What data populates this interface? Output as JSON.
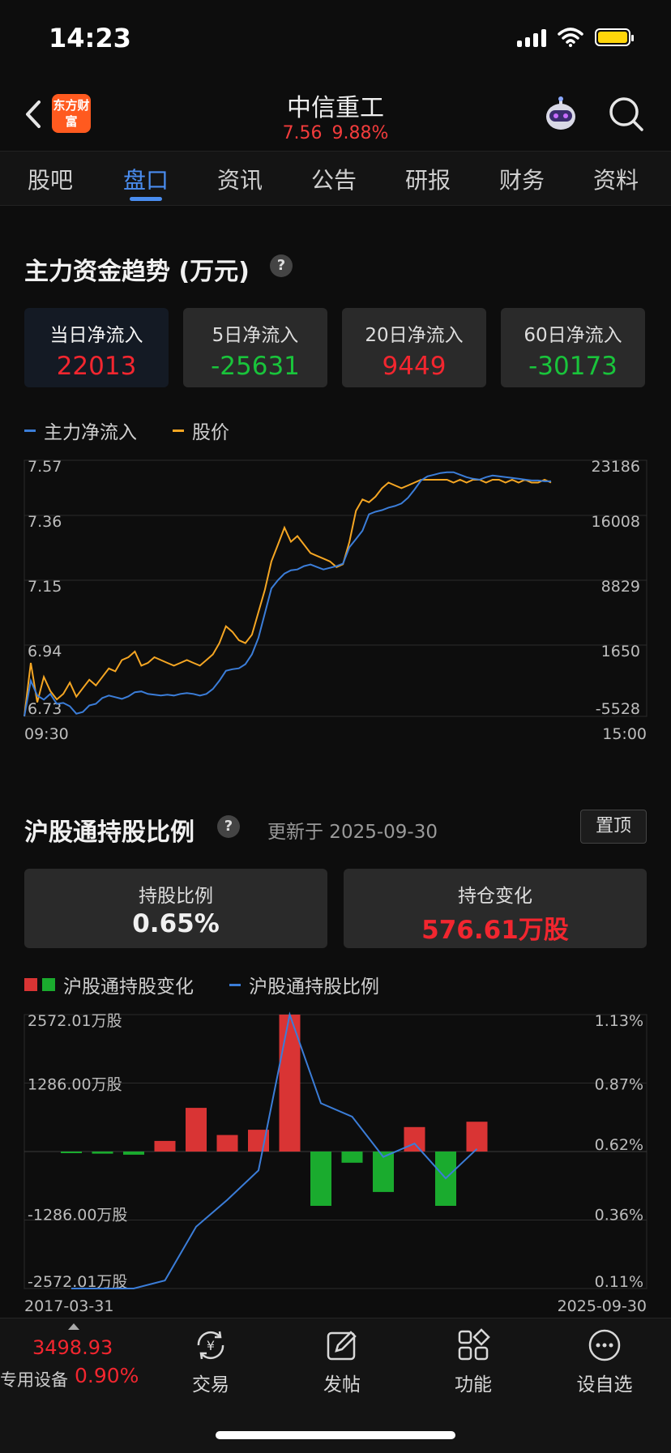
{
  "status": {
    "time": "14:23"
  },
  "header": {
    "logo_text": "东方财富",
    "stock_name": "中信重工",
    "price": "7.56",
    "change_pct": "9.88%"
  },
  "tabs": [
    {
      "label": "股吧"
    },
    {
      "label": "盘口"
    },
    {
      "label": "资讯"
    },
    {
      "label": "公告"
    },
    {
      "label": "研报"
    },
    {
      "label": "财务"
    },
    {
      "label": "资料"
    }
  ],
  "active_tab": "盘口",
  "fund_flow": {
    "title": "主力资金趋势 (万元)",
    "help": "?",
    "cards": [
      {
        "label": "当日净流入",
        "value": "22013"
      },
      {
        "label": "5日净流入",
        "value": "-25631"
      },
      {
        "label": "20日净流入",
        "value": "9449"
      },
      {
        "label": "60日净流入",
        "value": "-30173"
      }
    ],
    "legend": {
      "net_inflow": "主力净流入",
      "price": "股价"
    }
  },
  "chart_flow": {
    "type": "line",
    "left_ticks": [
      "7.57",
      "7.36",
      "7.15",
      "6.94",
      "6.73"
    ],
    "right_ticks": [
      "23186",
      "16008",
      "8829",
      "1650",
      "-5528"
    ],
    "x_start": "09:30",
    "x_end": "15:00",
    "price_ylim": [
      6.73,
      7.57
    ],
    "flow_ylim": [
      -5528,
      23186
    ],
    "series": [
      {
        "name": "股价",
        "color": "#f5a623",
        "values": [
          6.73,
          6.92,
          6.78,
          6.87,
          6.82,
          6.79,
          6.81,
          6.85,
          6.8,
          6.83,
          6.86,
          6.84,
          6.87,
          6.9,
          6.89,
          6.93,
          6.94,
          6.96,
          6.91,
          6.92,
          6.94,
          6.93,
          6.92,
          6.91,
          6.92,
          6.93,
          6.92,
          6.91,
          6.93,
          6.95,
          6.99,
          7.05,
          7.03,
          7.0,
          6.99,
          7.02,
          7.1,
          7.18,
          7.28,
          7.34,
          7.4,
          7.35,
          7.37,
          7.34,
          7.31,
          7.3,
          7.29,
          7.28,
          7.26,
          7.27,
          7.35,
          7.46,
          7.5,
          7.49,
          7.51,
          7.54,
          7.56,
          7.55,
          7.54,
          7.55,
          7.56,
          7.57,
          7.57,
          7.57,
          7.57,
          7.57,
          7.56,
          7.57,
          7.56,
          7.57,
          7.57,
          7.56,
          7.57,
          7.57,
          7.56,
          7.57,
          7.56,
          7.57,
          7.56,
          7.56,
          7.57,
          7.56
        ]
      },
      {
        "name": "主力净流入",
        "color": "#3b7dd8",
        "values": [
          -5528,
          -1200,
          -3000,
          -3500,
          -2800,
          -4000,
          -3900,
          -4300,
          -5200,
          -5000,
          -4200,
          -4000,
          -3300,
          -3000,
          -3200,
          -3400,
          -3100,
          -2600,
          -2500,
          -2800,
          -2900,
          -3000,
          -2900,
          -3000,
          -2800,
          -2700,
          -2800,
          -3000,
          -2800,
          -2200,
          -1200,
          0,
          200,
          300,
          800,
          2000,
          4000,
          7000,
          10000,
          11000,
          11800,
          12200,
          12300,
          12700,
          12900,
          12600,
          12300,
          12500,
          12700,
          13000,
          15000,
          16000,
          17000,
          19000,
          19300,
          19500,
          19800,
          20000,
          20300,
          21000,
          22000,
          23100,
          23600,
          23800,
          24000,
          24100,
          24100,
          23800,
          23500,
          23300,
          23200,
          23500,
          23700,
          23600,
          23500,
          23400,
          23300,
          23200,
          23100,
          23100,
          23000,
          23000
        ]
      }
    ]
  },
  "hgt": {
    "title": "沪股通持股比例",
    "help": "?",
    "update_text": "更新于 2025-09-30",
    "pin_label": "置顶",
    "hold_ratio_label": "持股比例",
    "hold_ratio_value": "0.65%",
    "hold_change_label": "持仓变化",
    "hold_change_value": "576.61万股",
    "legend": {
      "change": "沪股通持股变化",
      "ratio": "沪股通持股比例"
    }
  },
  "chart_hgt": {
    "type": "bar",
    "left_ticks": [
      "2572.01万股",
      "1286.00万股",
      "-1286.00万股",
      "-2572.01万股"
    ],
    "right_ticks": [
      "1.13%",
      "0.87%",
      "0.62%",
      "0.36%",
      "0.11%"
    ],
    "x_start": "2017-03-31",
    "x_end": "2025-09-30",
    "bar_ylim": [
      -2572.01,
      2572.01
    ],
    "ratio_ylim": [
      0.11,
      1.13
    ],
    "bar_values": [
      -20,
      -40,
      -60,
      200,
      820,
      310,
      410,
      2572,
      -1020,
      -210,
      -760,
      460,
      -1020,
      560
    ],
    "ratio_values": [
      0.11,
      0.11,
      0.11,
      0.14,
      0.34,
      0.44,
      0.55,
      1.13,
      0.8,
      0.75,
      0.6,
      0.65,
      0.52,
      0.63
    ],
    "colors": {
      "positive": "#d93434",
      "negative": "#1aab2e",
      "line": "#3b7dd8"
    }
  },
  "bottom_bar": {
    "index_value": "3498.93",
    "index_name": "专用设备",
    "index_pct": "0.90%",
    "items": [
      {
        "label": "交易",
        "icon": "trade-icon"
      },
      {
        "label": "发帖",
        "icon": "edit-icon"
      },
      {
        "label": "功能",
        "icon": "grid-icon"
      },
      {
        "label": "设自选",
        "icon": "more-icon"
      }
    ]
  }
}
